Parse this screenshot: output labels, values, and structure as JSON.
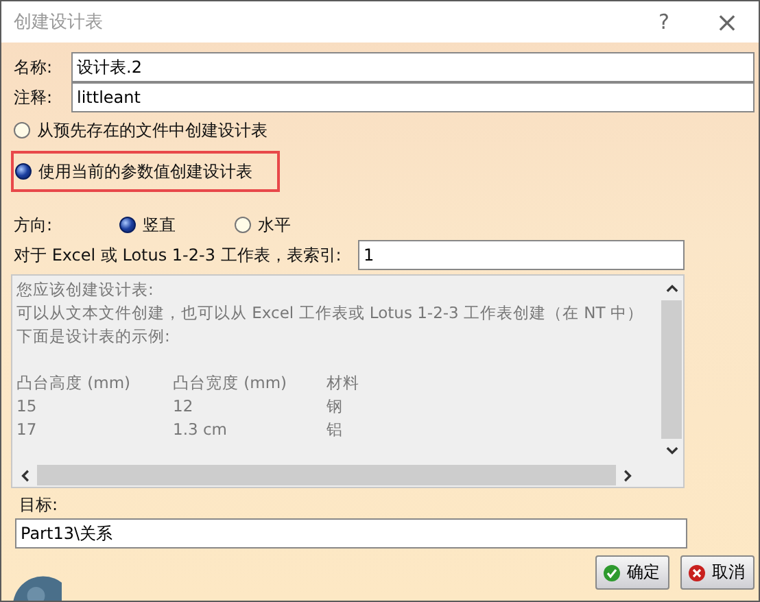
{
  "window": {
    "title": "创建设计表",
    "help": "?",
    "close": "×"
  },
  "name_field": {
    "label": "名称:",
    "value": "设计表.2"
  },
  "comment_field": {
    "label": "注释:",
    "value": "littleant"
  },
  "source_options": [
    {
      "label": "从预先存在的文件中创建设计表",
      "selected": false,
      "highlighted": false
    },
    {
      "label": "使用当前的参数值创建设计表",
      "selected": true,
      "highlighted": true
    }
  ],
  "orientation": {
    "label": "方向:",
    "options": [
      {
        "label": "竖直",
        "selected": true
      },
      {
        "label": "水平",
        "selected": false
      }
    ]
  },
  "sheet_index": {
    "label": "对于 Excel 或 Lotus 1-2-3 工作表，表索引:",
    "value": "1"
  },
  "info": {
    "lines": [
      "您应该创建设计表:",
      "可以从文本文件创建，也可以从 Excel 工作表或 Lotus 1-2-3 工作表创建（在 NT 中）",
      "下面是设计表的示例:"
    ],
    "rows": [
      [
        "凸台高度 (mm)",
        "凸台宽度 (mm)",
        "材料"
      ],
      [
        "15",
        "12",
        "钢"
      ],
      [
        "17",
        "1.3 cm",
        "铝"
      ]
    ]
  },
  "target": {
    "label": "目标:",
    "value": "Part13\\关系"
  },
  "buttons": [
    {
      "label": "确定",
      "kind": "ok"
    },
    {
      "label": "取消",
      "kind": "cancel"
    }
  ]
}
